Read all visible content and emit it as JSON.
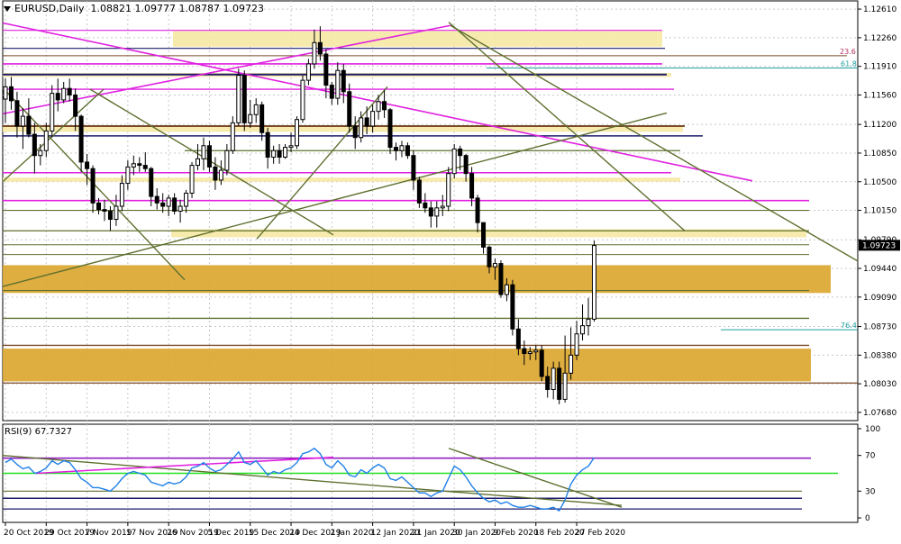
{
  "header": {
    "symbol": "EURUSD,Daily",
    "open": "1.08821",
    "high": "1.09777",
    "low": "1.08787",
    "close": "1.09723"
  },
  "rsi_header": {
    "label": "RSI(9)",
    "value": "67.7327"
  },
  "fib_labels": [
    "23.6",
    "61.8",
    "76.4"
  ],
  "colors": {
    "bull": "#ffffff",
    "bear": "#000000",
    "grid": "#c8c8c8",
    "yellow_zone": "#f6e8a4",
    "orange_zone": "#daa52c",
    "magenta": "#e020e0",
    "olive": "#5f7030",
    "navy": "#1c1c6c",
    "brown": "#7a4a28",
    "rsi_line": "#2080e8",
    "rsi_green": "#20e020",
    "rsi_purple": "#9020c0"
  },
  "chart_data": [
    {
      "type": "candlestick",
      "title": "EURUSD,Daily",
      "y_ticks": [
        "1.12610",
        "1.12260",
        "1.11910",
        "1.11560",
        "1.11200",
        "1.10850",
        "1.10500",
        "1.10150",
        "1.09790",
        "1.09440",
        "1.09090",
        "1.08730",
        "1.08380",
        "1.08030",
        "1.07680"
      ],
      "x_ticks": [
        "20 Oct 2019",
        "29 Oct 2019",
        "7 Nov 2019",
        "17 Nov 2019",
        "26 Nov 2019",
        "5 Dec 2019",
        "15 Dec 2019",
        "24 Dec 2019",
        "2 Jan 2020",
        "12 Jan 2020",
        "21 Jan 2020",
        "30 Jan 2020",
        "9 Feb 2020",
        "18 Feb 2020",
        "27 Feb 2020"
      ],
      "ylim": [
        1.0758,
        1.1271
      ],
      "current_price": "1.09723",
      "ohlc": [
        [
          1.1151,
          1.1176,
          1.1122,
          1.1166
        ],
        [
          1.1166,
          1.1178,
          1.1138,
          1.1149
        ],
        [
          1.1149,
          1.116,
          1.1104,
          1.1118
        ],
        [
          1.1118,
          1.114,
          1.109,
          1.113
        ],
        [
          1.113,
          1.1152,
          1.1104,
          1.1108
        ],
        [
          1.1108,
          1.1122,
          1.106,
          1.1082
        ],
        [
          1.1082,
          1.1096,
          1.107,
          1.1088
        ],
        [
          1.1088,
          1.1122,
          1.108,
          1.1112
        ],
        [
          1.1112,
          1.1168,
          1.1104,
          1.1158
        ],
        [
          1.1158,
          1.1176,
          1.1136,
          1.115
        ],
        [
          1.115,
          1.1172,
          1.1146,
          1.1164
        ],
        [
          1.1164,
          1.1176,
          1.1148,
          1.1156
        ],
        [
          1.1156,
          1.1164,
          1.1112,
          1.113
        ],
        [
          1.113,
          1.1132,
          1.1062,
          1.1074
        ],
        [
          1.1074,
          1.1084,
          1.1046,
          1.1066
        ],
        [
          1.1066,
          1.107,
          1.1012,
          1.1024
        ],
        [
          1.1024,
          1.103,
          1.101,
          1.1016
        ],
        [
          1.1016,
          1.1028,
          1.1002,
          1.1014
        ],
        [
          1.1014,
          1.102,
          1.099,
          1.1004
        ],
        [
          1.1004,
          1.1034,
          1.0996,
          1.102
        ],
        [
          1.102,
          1.1058,
          1.1014,
          1.1048
        ],
        [
          1.1048,
          1.1076,
          1.104,
          1.1068
        ],
        [
          1.1068,
          1.1082,
          1.1058,
          1.1072
        ],
        [
          1.1072,
          1.108,
          1.1062,
          1.107
        ],
        [
          1.107,
          1.1086,
          1.1062,
          1.1066
        ],
        [
          1.1066,
          1.1068,
          1.102,
          1.1032
        ],
        [
          1.1032,
          1.1042,
          1.1016,
          1.1024
        ],
        [
          1.1024,
          1.1036,
          1.1012,
          1.102
        ],
        [
          1.102,
          1.1034,
          1.1008,
          1.103
        ],
        [
          1.103,
          1.1036,
          1.101,
          1.1014
        ],
        [
          1.1014,
          1.1028,
          1.1,
          1.102
        ],
        [
          1.102,
          1.104,
          1.1012,
          1.1036
        ],
        [
          1.1036,
          1.1074,
          1.103,
          1.107
        ],
        [
          1.107,
          1.1096,
          1.1064,
          1.1078
        ],
        [
          1.1078,
          1.1104,
          1.1064,
          1.1094
        ],
        [
          1.1094,
          1.11,
          1.1062,
          1.1068
        ],
        [
          1.1068,
          1.108,
          1.104,
          1.1052
        ],
        [
          1.1052,
          1.1076,
          1.1046,
          1.1064
        ],
        [
          1.1064,
          1.1096,
          1.1058,
          1.1088
        ],
        [
          1.1088,
          1.113,
          1.1084,
          1.1122
        ],
        [
          1.1122,
          1.1188,
          1.1118,
          1.118
        ],
        [
          1.118,
          1.1186,
          1.1112,
          1.1122
        ],
        [
          1.1122,
          1.115,
          1.1116,
          1.1132
        ],
        [
          1.1132,
          1.1152,
          1.1122,
          1.1144
        ],
        [
          1.1144,
          1.1148,
          1.11,
          1.111
        ],
        [
          1.111,
          1.1116,
          1.1066,
          1.108
        ],
        [
          1.108,
          1.1094,
          1.1072,
          1.1088
        ],
        [
          1.1088,
          1.1096,
          1.1072,
          1.108
        ],
        [
          1.108,
          1.1096,
          1.1078,
          1.1092
        ],
        [
          1.1092,
          1.111,
          1.1086,
          1.1094
        ],
        [
          1.1094,
          1.113,
          1.109,
          1.1126
        ],
        [
          1.1126,
          1.118,
          1.1122,
          1.1174
        ],
        [
          1.1174,
          1.12,
          1.1168,
          1.1194
        ],
        [
          1.1194,
          1.1236,
          1.1188,
          1.122
        ],
        [
          1.122,
          1.124,
          1.1198,
          1.1206
        ],
        [
          1.1206,
          1.1212,
          1.1152,
          1.1168
        ],
        [
          1.1168,
          1.1172,
          1.1144,
          1.1152
        ],
        [
          1.1152,
          1.1196,
          1.1144,
          1.1186
        ],
        [
          1.1186,
          1.1194,
          1.1146,
          1.116
        ],
        [
          1.116,
          1.117,
          1.111,
          1.1118
        ],
        [
          1.1118,
          1.113,
          1.109,
          1.1104
        ],
        [
          1.1104,
          1.1136,
          1.1098,
          1.1128
        ],
        [
          1.1128,
          1.1142,
          1.1108,
          1.1118
        ],
        [
          1.1118,
          1.1144,
          1.111,
          1.1136
        ],
        [
          1.1136,
          1.1156,
          1.1126,
          1.1148
        ],
        [
          1.1148,
          1.1162,
          1.1128,
          1.1138
        ],
        [
          1.1138,
          1.114,
          1.1084,
          1.1092
        ],
        [
          1.1092,
          1.1098,
          1.1076,
          1.1088
        ],
        [
          1.1088,
          1.11,
          1.108,
          1.1094
        ],
        [
          1.1094,
          1.1098,
          1.1078,
          1.1082
        ],
        [
          1.1082,
          1.1088,
          1.104,
          1.1052
        ],
        [
          1.1052,
          1.1056,
          1.1018,
          1.1024
        ],
        [
          1.1024,
          1.1036,
          1.1012,
          1.1018
        ],
        [
          1.1018,
          1.1026,
          1.0994,
          1.1008
        ],
        [
          1.1008,
          1.1026,
          1.0994,
          1.1018
        ],
        [
          1.1018,
          1.1034,
          1.1008,
          1.102
        ],
        [
          1.102,
          1.1068,
          1.1014,
          1.106
        ],
        [
          1.106,
          1.1096,
          1.1054,
          1.109
        ],
        [
          1.109,
          1.1094,
          1.1064,
          1.1082
        ],
        [
          1.1082,
          1.1084,
          1.105,
          1.106
        ],
        [
          1.106,
          1.1068,
          1.102,
          1.103
        ],
        [
          1.103,
          1.1034,
          1.0988,
          1.1
        ],
        [
          1.1,
          1.1,
          1.0962,
          1.097
        ],
        [
          1.097,
          1.0972,
          1.0938,
          1.0946
        ],
        [
          1.0946,
          1.0956,
          1.093,
          1.095
        ],
        [
          1.095,
          1.0954,
          1.0908,
          1.0912
        ],
        [
          1.0912,
          1.0932,
          1.0904,
          1.0924
        ],
        [
          1.0924,
          1.093,
          1.0862,
          1.087
        ],
        [
          1.087,
          1.0882,
          1.0838,
          1.0846
        ],
        [
          1.0846,
          1.0856,
          1.0826,
          1.084
        ],
        [
          1.084,
          1.0848,
          1.0832,
          1.0842
        ],
        [
          1.0842,
          1.085,
          1.0832,
          1.0844
        ],
        [
          1.0844,
          1.085,
          1.0806,
          1.0812
        ],
        [
          1.0812,
          1.0824,
          1.0786,
          1.0796
        ],
        [
          1.0796,
          1.083,
          1.0784,
          1.0822
        ],
        [
          1.0822,
          1.083,
          1.0778,
          1.0784
        ],
        [
          1.0784,
          1.0862,
          1.078,
          1.0816
        ],
        [
          1.0816,
          1.0872,
          1.0808,
          1.0838
        ],
        [
          1.0838,
          1.088,
          1.0832,
          1.0864
        ],
        [
          1.0864,
          1.09,
          1.0856,
          1.0874
        ],
        [
          1.0874,
          1.0908,
          1.0862,
          1.0882
        ],
        [
          1.0882,
          1.0978,
          1.0879,
          1.0972
        ]
      ],
      "rsi": {
        "label": "RSI(9)",
        "y_ticks": [
          "100",
          "70",
          "30",
          "0"
        ],
        "ylim": [
          -5,
          105
        ],
        "values": [
          62,
          66,
          60,
          55,
          57,
          50,
          52,
          56,
          64,
          60,
          64,
          62,
          54,
          44,
          40,
          34,
          34,
          32,
          30,
          36,
          44,
          50,
          52,
          50,
          48,
          40,
          38,
          36,
          40,
          38,
          40,
          46,
          56,
          58,
          62,
          56,
          52,
          54,
          60,
          66,
          74,
          62,
          60,
          64,
          56,
          48,
          52,
          50,
          54,
          56,
          62,
          72,
          74,
          78,
          72,
          60,
          56,
          64,
          58,
          48,
          46,
          54,
          50,
          56,
          60,
          56,
          44,
          42,
          46,
          40,
          34,
          28,
          28,
          24,
          28,
          30,
          44,
          58,
          54,
          46,
          36,
          28,
          22,
          18,
          20,
          16,
          18,
          14,
          12,
          12,
          14,
          12,
          10,
          10,
          12,
          8,
          20,
          38,
          48,
          54,
          58,
          67.7
        ]
      }
    }
  ]
}
